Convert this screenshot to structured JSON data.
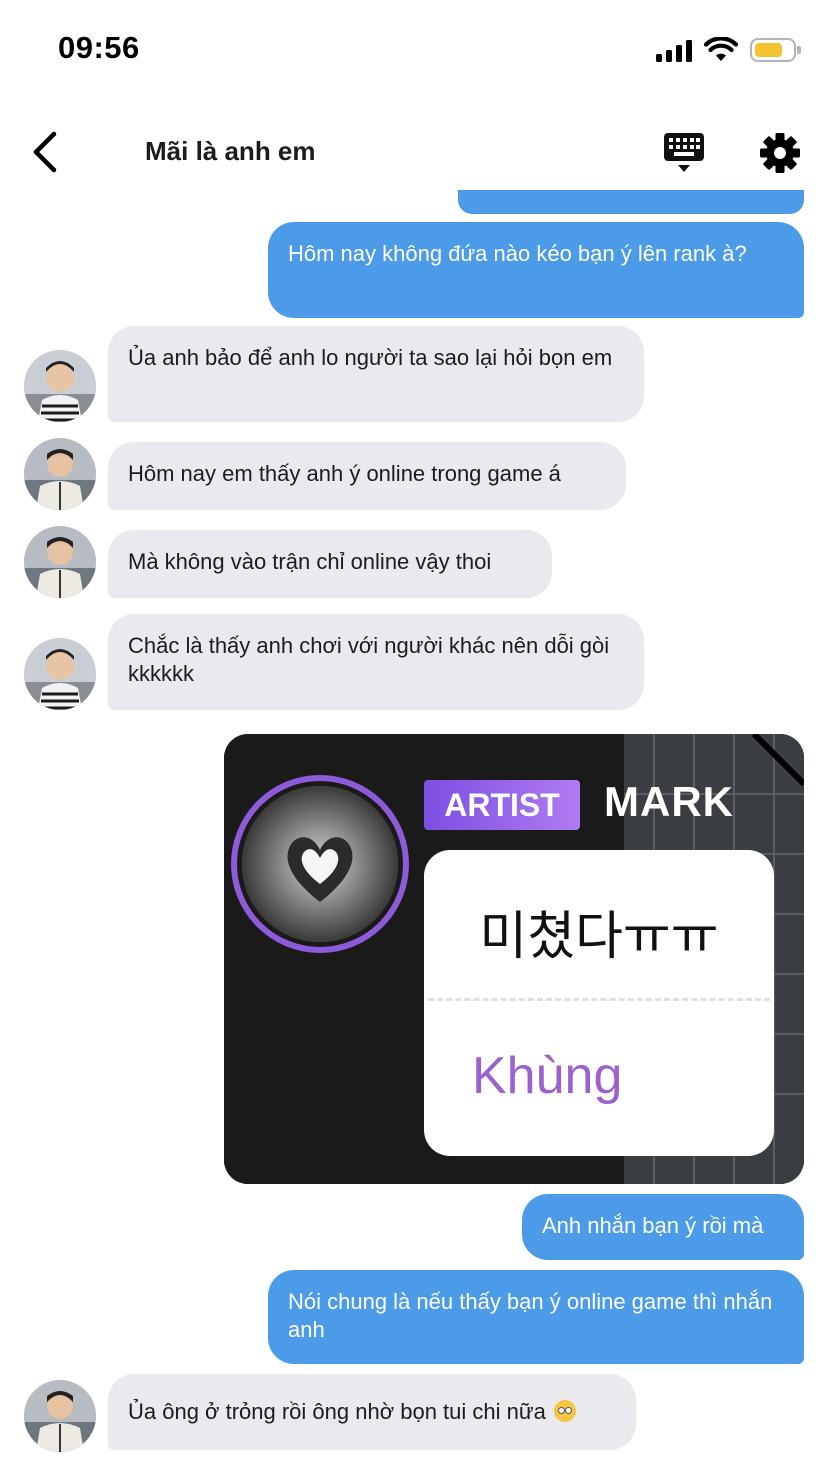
{
  "status_bar": {
    "time": "09:56",
    "battery_level": 0.75,
    "battery_color": "#f3c331"
  },
  "header": {
    "title": "Mãi là anh em",
    "back_icon": "chevron-left-icon",
    "keyboard_icon": "keyboard-icon",
    "settings_icon": "gear-icon"
  },
  "colors": {
    "outgoing_bubble": "#4c9be8",
    "incoming_bubble": "#e9e9ee"
  },
  "messages": [
    {
      "direction": "out",
      "text": "Hôm nay không đứa nào kéo bạn ý lên rank à?"
    },
    {
      "direction": "in",
      "text": "Ủa anh bảo để anh lo người ta sao lại hỏi bọn em"
    },
    {
      "direction": "in",
      "text": "Hôm nay em thấy anh ý online trong game á"
    },
    {
      "direction": "in",
      "text": "Mà không vào trận chỉ online vậy thoi"
    },
    {
      "direction": "in",
      "text": "Chắc là thấy anh chơi với người khác nên dỗi gòi kkkkkk"
    },
    {
      "direction": "out",
      "type": "image"
    },
    {
      "direction": "out",
      "text": "Anh nhắn bạn ý rồi mà"
    },
    {
      "direction": "out",
      "text": "Nói chung là nếu thấy bạn ý online game thì nhắn anh"
    },
    {
      "direction": "in",
      "text": "Ủa ông ở trỏng rồi ông nhờ bọn tui chi nữa",
      "emoji": "eye-roll-emoji-icon"
    }
  ],
  "image_message": {
    "badge": "ARTIST",
    "name": "MARK",
    "korean_text": "미쳤다ㅠㅠ",
    "translation": "Khùng",
    "avatar_icon": "heart-hands-photo"
  }
}
